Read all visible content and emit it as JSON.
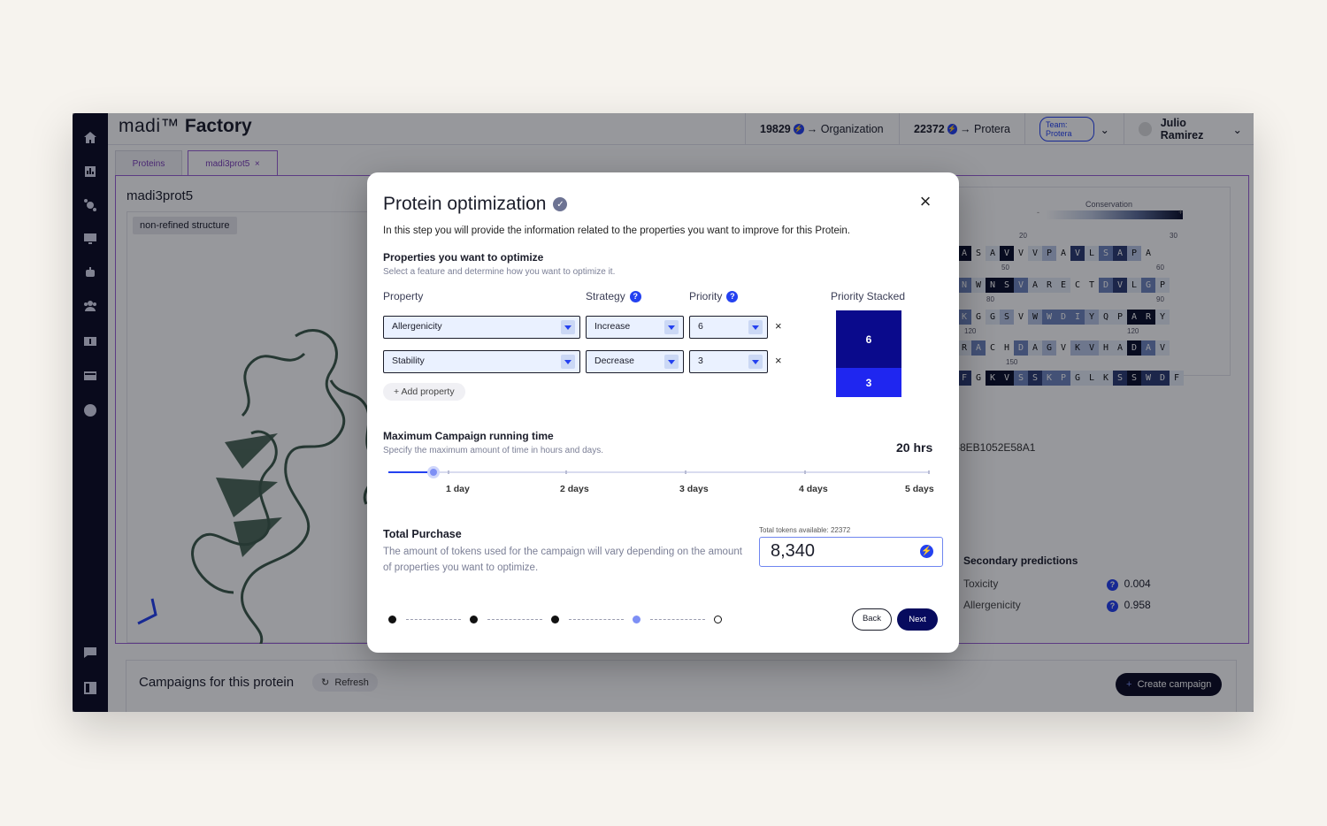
{
  "app": {
    "logo_madi": "madi™",
    "logo_factory": "Factory",
    "org_tokens": "19829",
    "org_label": "Organization",
    "user_tokens": "22372",
    "user_label": "Protera",
    "team": "Team: Protera",
    "user_name": "Julio Ramirez",
    "arrow": "→"
  },
  "sidebar_icons": [
    "home-icon",
    "chart-icon",
    "molecule-icon",
    "monitor-icon",
    "robot-icon",
    "team-icon",
    "billing-icon",
    "card-icon",
    "bolt-icon",
    "chat-icon",
    "collapse-icon"
  ],
  "tabs": [
    {
      "label": "Proteins"
    },
    {
      "label": "madi3prot5",
      "close": "×"
    }
  ],
  "protein": {
    "title": "madi3prot5",
    "structure_tag": "non-refined structure",
    "id_fragment": "-8EB1052E58A1",
    "conservation_label": "Conservation",
    "cons_minus": "-",
    "cons_plus": "+",
    "seq_numbers": [
      "20",
      "30",
      "50",
      "60",
      "80",
      "90",
      "120",
      "120",
      "150"
    ],
    "seq_rows": [
      "ASAVVVPAVLSAPA",
      "NWNSVAREСTDVLGP",
      "KGGSVWWDIYQPARY",
      "RACHDAGVKVHADAV",
      "FGKVSSKPGLKSSWDF"
    ]
  },
  "secondary": {
    "title": "Secondary predictions",
    "rows": [
      {
        "label": "Toxicity",
        "value": "0.004"
      },
      {
        "label": "Allergenicity",
        "value": "0.958"
      }
    ]
  },
  "campaigns": {
    "title": "Campaigns for this protein",
    "refresh": "Refresh",
    "create": "Create campaign"
  },
  "modal": {
    "title": "Protein optimization",
    "close": "×",
    "description": "In this step you will provide the information related to the properties you want to improve for this Protein.",
    "properties_heading": "Properties you want to optimize",
    "properties_sub": "Select a feature and determine how you want to optimize it.",
    "col_property": "Property",
    "col_strategy": "Strategy",
    "col_priority": "Priority",
    "col_stacked": "Priority Stacked",
    "rows": [
      {
        "property": "Allergenicity",
        "strategy": "Increase",
        "priority": "6",
        "remove": "×"
      },
      {
        "property": "Stability",
        "strategy": "Decrease",
        "priority": "3",
        "remove": "×"
      }
    ],
    "add_property": "+ Add property",
    "stacked": [
      {
        "value": "6",
        "color": "#0a0a8c"
      },
      {
        "value": "3",
        "color": "#1f26f0"
      }
    ],
    "time_heading": "Maximum Campaign running time",
    "time_sub": "Specify the maximum amount of time in hours and days.",
    "time_value": "20 hrs",
    "slider_fraction": 0.0833,
    "slider_labels": [
      "1 day",
      "2 days",
      "3 days",
      "4 days",
      "5 days"
    ],
    "total_heading": "Total Purchase",
    "total_desc": "The amount of tokens used for the campaign will vary depending on the amount of properties you want to optimize.",
    "tokens_available": "Total tokens available: 22372",
    "tokens_value": "8,340",
    "steps": [
      "done",
      "done",
      "done",
      "current",
      "todo"
    ],
    "back": "Back",
    "next": "Next"
  },
  "colors": {
    "accent": "#2441f0",
    "sidebar": "#0b0c23",
    "next_button": "#070b5e",
    "tab_border": "#9a5fd6"
  }
}
